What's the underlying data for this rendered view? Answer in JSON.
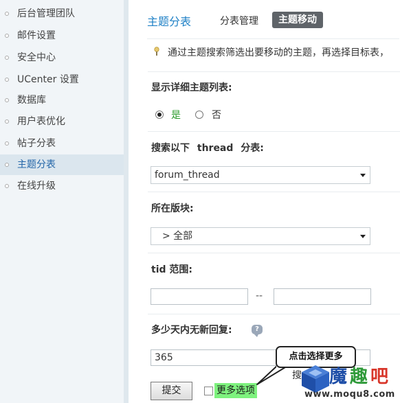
{
  "sidebar": {
    "items": [
      {
        "label": "后台管理团队"
      },
      {
        "label": "邮件设置"
      },
      {
        "label": "安全中心"
      },
      {
        "label": "UCenter 设置"
      },
      {
        "label": "数据库"
      },
      {
        "label": "用户表优化"
      },
      {
        "label": "帖子分表"
      },
      {
        "label": "主题分表",
        "active": true
      },
      {
        "label": "在线升级"
      }
    ]
  },
  "header": {
    "title": "主题分表",
    "tabs": [
      {
        "label": "分表管理"
      },
      {
        "label": "主题移动",
        "active": true
      }
    ]
  },
  "tip": {
    "text": "通过主题搜索筛选出要移动的主题，再选择目标表，"
  },
  "form": {
    "detail_list": {
      "label": "显示详细主题列表:",
      "option_yes": "是",
      "option_no": "否",
      "selected": "是"
    },
    "search_table": {
      "label_prefix": "搜索以下",
      "label_keyword": "thread",
      "label_suffix": "分表:",
      "value": "forum_thread"
    },
    "forum": {
      "label": "所在版块:",
      "value": "> 全部"
    },
    "tid_range": {
      "label": "tid 范围:",
      "separator": "--",
      "from": "",
      "to": ""
    },
    "days": {
      "label": "多少天内无新回复:",
      "value": "365"
    },
    "submit_label": "提交",
    "more_options_label": "更多选项",
    "obscured_button_text": "搜"
  },
  "callout": {
    "text": "点击选择更多"
  },
  "watermark": {
    "brand_1": "魔",
    "brand_2": "趣",
    "brand_3": "吧",
    "url": "www.moqu8.com"
  },
  "colors": {
    "accent": "#1e80c6",
    "highlight": "#7ef27e",
    "active_tab_bg": "#5f6469",
    "yes_text": "#2a9a2a"
  }
}
